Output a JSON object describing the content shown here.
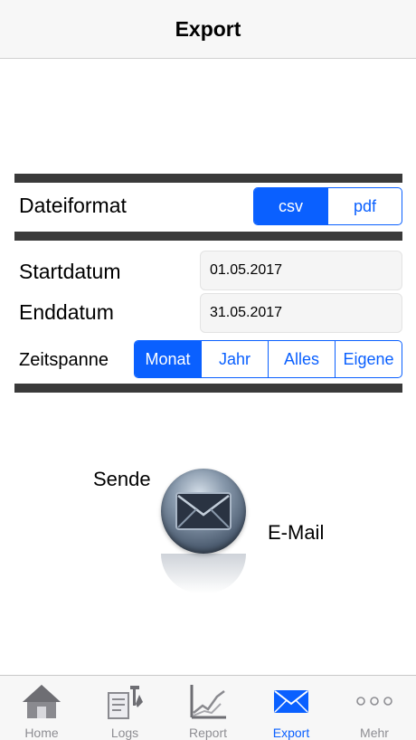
{
  "navbar": {
    "title": "Export"
  },
  "file_format": {
    "label": "Dateiformat",
    "options": [
      "csv",
      "pdf"
    ],
    "selected": "csv"
  },
  "start_date": {
    "label": "Startdatum",
    "value": "01.05.2017"
  },
  "end_date": {
    "label": "Enddatum",
    "value": "31.05.2017"
  },
  "timespan": {
    "label": "Zeitspanne",
    "options": [
      "Monat",
      "Jahr",
      "Alles",
      "Eigene"
    ],
    "selected": "Monat"
  },
  "send": {
    "label_left": "Sende",
    "label_right": "E-Mail",
    "icon": "mail-envelope-icon"
  },
  "tabbar": {
    "items": [
      {
        "label": "Home",
        "icon": "home-icon"
      },
      {
        "label": "Logs",
        "icon": "logs-icon"
      },
      {
        "label": "Report",
        "icon": "report-chart-icon"
      },
      {
        "label": "Export",
        "icon": "envelope-icon"
      },
      {
        "label": "Mehr",
        "icon": "more-dots-icon"
      }
    ],
    "active": "Export"
  },
  "colors": {
    "accent": "#0a60ff",
    "separator": "#3a3a3a",
    "inactive_tab": "#8e8e93"
  }
}
